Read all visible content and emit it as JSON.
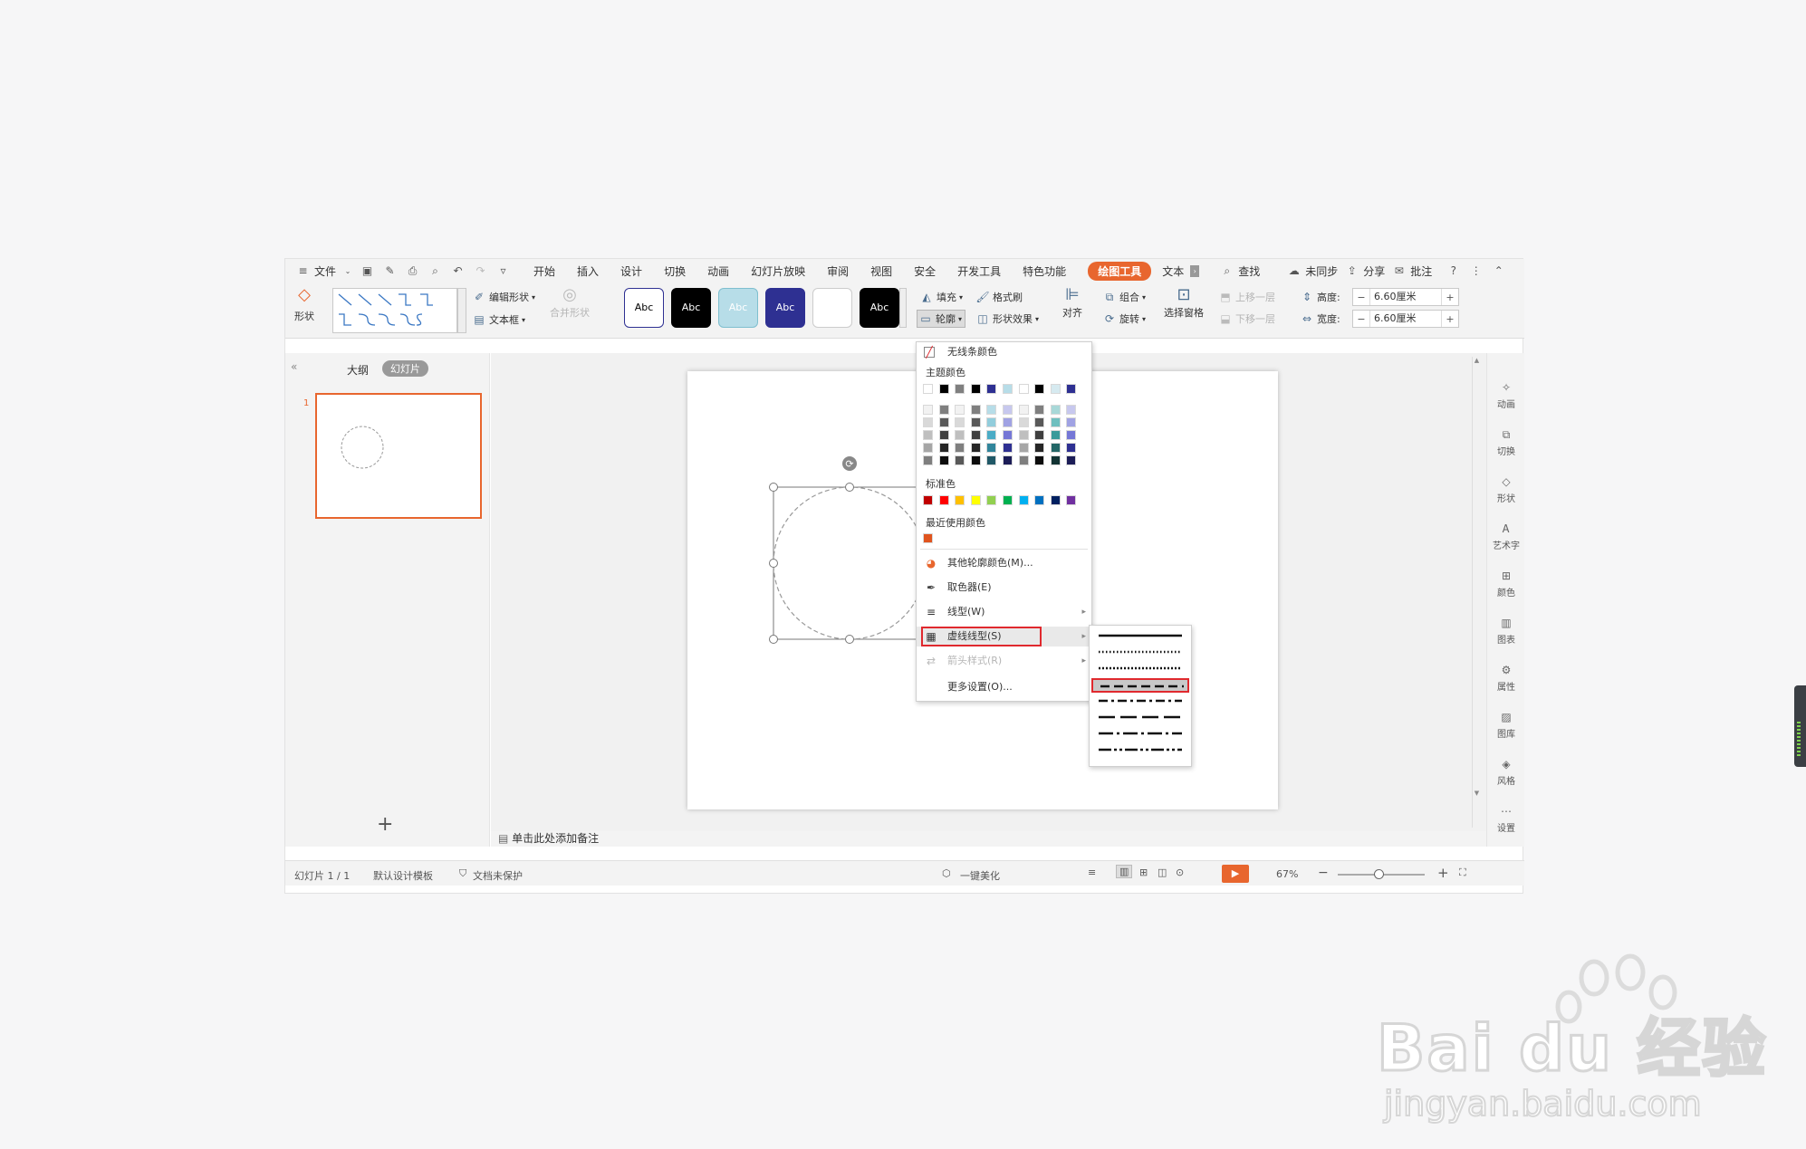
{
  "menubar": {
    "file": "文件",
    "tabs": [
      "开始",
      "插入",
      "设计",
      "切换",
      "动画",
      "幻灯片放映",
      "审阅",
      "视图",
      "安全",
      "开发工具",
      "特色功能"
    ],
    "active_tab": "绘图工具",
    "text_tab": "文本",
    "search": "查找",
    "sync": "未同步",
    "share": "分享",
    "comment": "批注"
  },
  "ribbon": {
    "shapes": "形状",
    "edit_shape": "编辑形状",
    "textbox": "文本框",
    "merge_shapes": "合并形状",
    "style_label": "Abc",
    "fill": "填充",
    "format_painter": "格式刷",
    "outline": "轮廓",
    "shape_effects": "形状效果",
    "align": "对齐",
    "group": "组合",
    "rotate": "旋转",
    "selection_pane": "选择窗格",
    "bring_forward": "上移一层",
    "send_backward": "下移一层",
    "height_label": "高度:",
    "width_label": "宽度:",
    "height_value": "6.60厘米",
    "width_value": "6.60厘米"
  },
  "left_panel": {
    "outline_tab": "大纲",
    "slides_tab": "幻灯片",
    "slide_number": "1",
    "add": "+"
  },
  "right_bar": [
    "动画",
    "切换",
    "形状",
    "艺术字",
    "颜色",
    "图表",
    "属性",
    "图库",
    "风格",
    "设置"
  ],
  "notes_placeholder": "单击此处添加备注",
  "status": {
    "slide_info": "幻灯片 1 / 1",
    "template": "默认设计模板",
    "protection": "文档未保护",
    "beautify": "一键美化",
    "zoom": "67%"
  },
  "outline_menu": {
    "no_line_color": "无线条颜色",
    "theme_colors": "主题颜色",
    "standard_colors": "标准色",
    "recent_colors": "最近使用颜色",
    "other_colors": "其他轮廓颜色(M)...",
    "eyedropper": "取色器(E)",
    "line_type": "线型(W)",
    "dash_type": "虚线线型(S)",
    "arrow_style": "箭头样式(R)",
    "more_settings": "更多设置(O)..."
  },
  "colors": {
    "theme_row": [
      "#ffffff",
      "#000000",
      "#7f7f7f",
      "#000000",
      "#2e3092",
      "#b7dde8",
      "#ffffff",
      "#000000",
      "#d6eaf0",
      "#2e3092"
    ],
    "theme_cols": [
      [
        "#f2f2f2",
        "#d9d9d9",
        "#bfbfbf",
        "#a6a6a6",
        "#7f7f7f"
      ],
      [
        "#7f7f7f",
        "#595959",
        "#3f3f3f",
        "#262626",
        "#0d0d0d"
      ],
      [
        "#f2f2f2",
        "#d9d9d9",
        "#bfbfbf",
        "#7f7f7f",
        "#595959"
      ],
      [
        "#7f7f7f",
        "#595959",
        "#3f3f3f",
        "#262626",
        "#0d0d0d"
      ],
      [
        "#b7dde8",
        "#92cddc",
        "#4bacc6",
        "#31859b",
        "#205867"
      ],
      [
        "#c7c8ee",
        "#a0a2e3",
        "#7577d6",
        "#2e3092",
        "#1c1d57"
      ],
      [
        "#f2f2f2",
        "#d9d9d9",
        "#bfbfbf",
        "#a6a6a6",
        "#7f7f7f"
      ],
      [
        "#7f7f7f",
        "#595959",
        "#3f3f3f",
        "#262626",
        "#0d0d0d"
      ],
      [
        "#a8d8d8",
        "#6fbfbf",
        "#3a9a9a",
        "#236666",
        "#123333"
      ],
      [
        "#c7c8ee",
        "#a0a2e3",
        "#7577d6",
        "#2e3092",
        "#1c1d57"
      ]
    ],
    "standard": [
      "#c00000",
      "#ff0000",
      "#ffc000",
      "#ffff00",
      "#92d050",
      "#00b050",
      "#00b0f0",
      "#0070c0",
      "#002060",
      "#7030a0"
    ],
    "recent": [
      "#e0541e"
    ],
    "accent": "#e8662e",
    "highlight": "#e0292e"
  },
  "style_swatches": [
    {
      "bg": "#ffffff",
      "fg": "#000000",
      "border": "#2e3092"
    },
    {
      "bg": "#000000",
      "fg": "#ffffff",
      "border": "#000000"
    },
    {
      "bg": "#b7dde8",
      "fg": "#ffffff",
      "border": "#7fbfcf"
    },
    {
      "bg": "#2e3092",
      "fg": "#ffffff",
      "border": "#2e3092"
    },
    {
      "bg": "#ffffff",
      "fg": "#ffffff",
      "border": "#cccccc"
    },
    {
      "bg": "#000000",
      "fg": "#ffffff",
      "border": "#000000"
    }
  ],
  "dash_options": [
    "solid",
    "round-dot",
    "square-dot",
    "dash",
    "dash-dot",
    "long-dash",
    "long-dash-dot",
    "long-dash-dot-dot"
  ],
  "watermark": {
    "brand": "Bai du 经验",
    "url": "jingyan.baidu.com"
  }
}
